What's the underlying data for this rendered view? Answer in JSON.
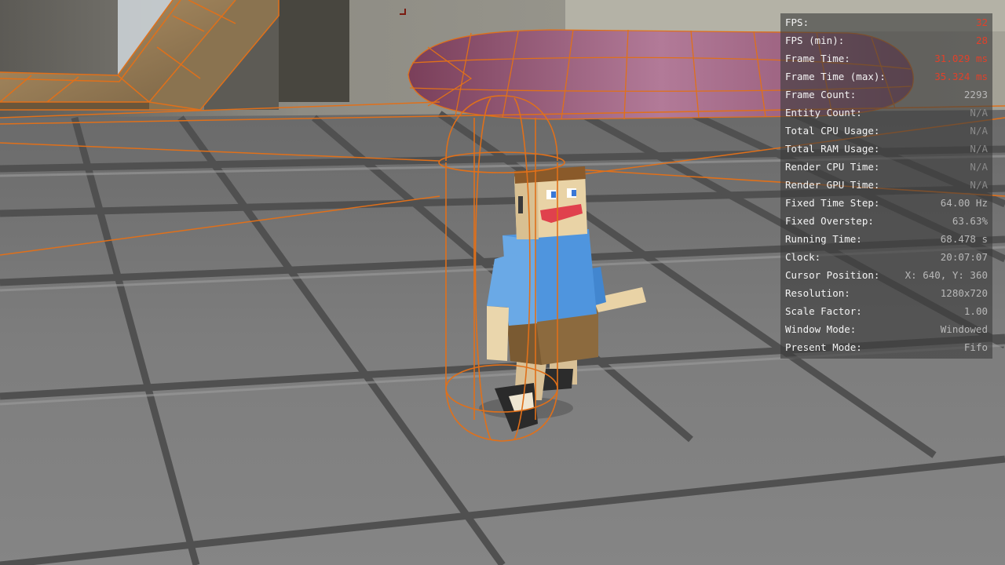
{
  "diagnostics": {
    "rows": [
      {
        "label": "FPS:",
        "value": "32",
        "status": "bad"
      },
      {
        "label": "FPS (min):",
        "value": "28",
        "status": "bad"
      },
      {
        "label": "Frame Time:",
        "value": "31.029 ms",
        "status": "bad"
      },
      {
        "label": "Frame Time (max):",
        "value": "35.324 ms",
        "status": "bad"
      },
      {
        "label": "Frame Count:",
        "value": "2293",
        "status": "normal"
      },
      {
        "label": "Entity Count:",
        "value": "N/A",
        "status": "dim"
      },
      {
        "label": "Total CPU Usage:",
        "value": "N/A",
        "status": "dim"
      },
      {
        "label": "Total RAM Usage:",
        "value": "N/A",
        "status": "dim"
      },
      {
        "label": "Render CPU Time:",
        "value": "N/A",
        "status": "dim"
      },
      {
        "label": "Render GPU Time:",
        "value": "N/A",
        "status": "dim"
      },
      {
        "label": "Fixed Time Step:",
        "value": "64.00 Hz",
        "status": "normal"
      },
      {
        "label": "Fixed Overstep:",
        "value": "63.63%",
        "status": "normal"
      },
      {
        "label": "Running Time:",
        "value": "68.478 s",
        "status": "normal"
      },
      {
        "label": "Clock:",
        "value": "20:07:07",
        "status": "normal"
      },
      {
        "label": "Cursor Position:",
        "value": "X: 640, Y: 360",
        "status": "normal"
      },
      {
        "label": "Resolution:",
        "value": "1280x720",
        "status": "normal"
      },
      {
        "label": "Scale Factor:",
        "value": "1.00",
        "status": "normal"
      },
      {
        "label": "Window Mode:",
        "value": "Windowed",
        "status": "normal"
      },
      {
        "label": "Present Mode:",
        "value": "Fifo",
        "status": "normal"
      }
    ]
  },
  "scene": {
    "colors": {
      "floor": "#7a7a7a",
      "floor_line": "#4a4a4a",
      "wall": "#8c8a82",
      "wireframe": "#e0701a",
      "ramp": "#a98a5c",
      "blob": "#a8698c",
      "shirt": "#4f95de",
      "shorts": "#8c6a3e",
      "skin": "#e9d3a6",
      "hair": "#8a5a2a",
      "mouth": "#e0414d"
    }
  }
}
